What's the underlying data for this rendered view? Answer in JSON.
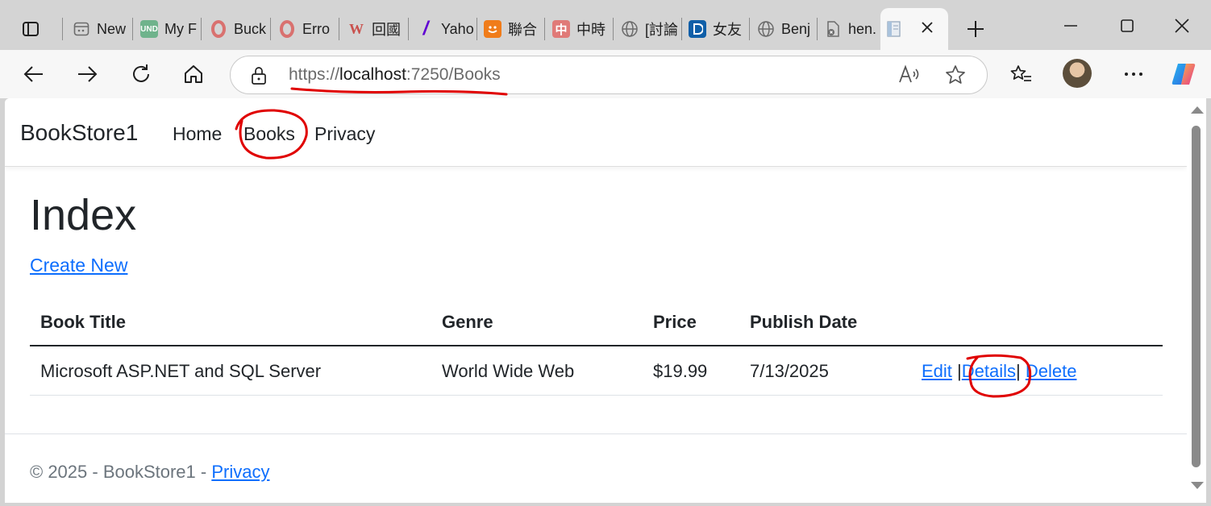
{
  "tabs": [
    {
      "label": "New",
      "icon": "new-tab-page-icon",
      "color": "#6b6b6b"
    },
    {
      "label": "My F",
      "icon": "und-logo-icon",
      "color": "#6fb38c"
    },
    {
      "label": "Buck",
      "icon": "opera-logo-icon",
      "color": "#d24b4b"
    },
    {
      "label": "Erro",
      "icon": "opera-logo-icon",
      "color": "#d24b4b"
    },
    {
      "label": "回國",
      "icon": "w-logo-icon",
      "color": "#c9514d"
    },
    {
      "label": "Yaho",
      "icon": "yahoo-logo-icon",
      "color": "#6001d2"
    },
    {
      "label": "聯合",
      "icon": "udn-logo-icon",
      "color": "#f07c1a"
    },
    {
      "label": "中時",
      "icon": "chinatimes-logo-icon",
      "color": "#d9534f"
    },
    {
      "label": "[討論",
      "icon": "globe-icon",
      "color": "#6b6b6b"
    },
    {
      "label": "女友",
      "icon": "dcard-logo-icon",
      "color": "#0f5fa8"
    },
    {
      "label": "Benj",
      "icon": "globe-icon",
      "color": "#6b6b6b"
    },
    {
      "label": "hen.",
      "icon": "file-error-icon",
      "color": "#6b6b6b"
    }
  ],
  "address": {
    "scheme": "https://",
    "host": "localhost",
    "rest": ":7250/Books"
  },
  "site": {
    "brand": "BookStore1",
    "nav": [
      "Home",
      "Books",
      "Privacy"
    ],
    "heading": "Index",
    "create_new": "Create New"
  },
  "table": {
    "headers": [
      "Book Title",
      "Genre",
      "Price",
      "Publish Date"
    ],
    "rows": [
      {
        "title": "Microsoft ASP.NET and SQL Server",
        "genre": "World Wide Web",
        "price": "$19.99",
        "date": "7/13/2025"
      }
    ],
    "actions": {
      "edit": "Edit",
      "details": "Details",
      "delete": "Delete",
      "sep": "|"
    }
  },
  "footer": {
    "text": "© 2025 - BookStore1 - ",
    "link": "Privacy"
  },
  "colors": {
    "link": "#0d6efd",
    "annotation": "#e00000"
  }
}
